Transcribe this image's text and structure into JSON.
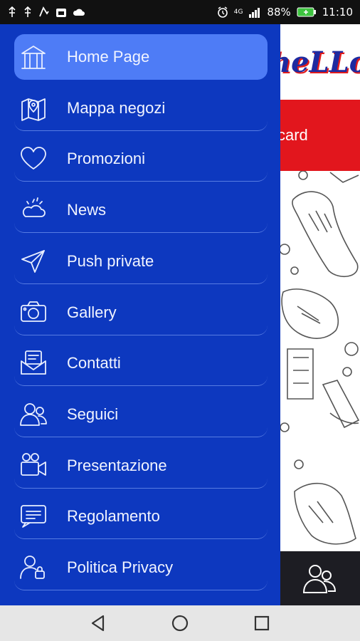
{
  "status_bar": {
    "battery_percent": "88%",
    "time": "11:10",
    "signal_label": "4G"
  },
  "background_app": {
    "logo_text": "heLLo",
    "red_band_text": "card"
  },
  "menu": {
    "items": [
      {
        "label": "Home Page",
        "icon": "home-icon",
        "active": true
      },
      {
        "label": "Mappa negozi",
        "icon": "map-icon",
        "active": false
      },
      {
        "label": "Promozioni",
        "icon": "heart-icon",
        "active": false
      },
      {
        "label": "News",
        "icon": "weather-icon",
        "active": false
      },
      {
        "label": "Push private",
        "icon": "send-icon",
        "active": false
      },
      {
        "label": "Gallery",
        "icon": "camera-icon",
        "active": false
      },
      {
        "label": "Contatti",
        "icon": "mail-icon",
        "active": false
      },
      {
        "label": "Seguici",
        "icon": "users-icon",
        "active": false
      },
      {
        "label": "Presentazione",
        "icon": "video-camera-icon",
        "active": false
      },
      {
        "label": "Regolamento",
        "icon": "message-icon",
        "active": false
      },
      {
        "label": "Politica Privacy",
        "icon": "user-lock-icon",
        "active": false
      }
    ]
  },
  "colors": {
    "drawer_bg": "#0d38bf",
    "active_item_bg": "#4e7cf6",
    "brand_red": "#e2161d"
  }
}
